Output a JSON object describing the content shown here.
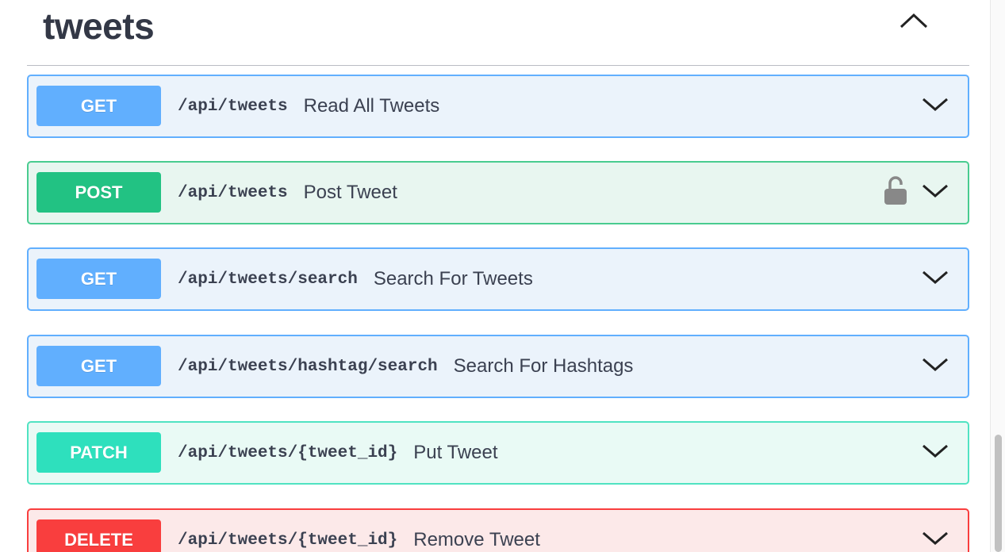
{
  "section": {
    "title": "tweets",
    "collapse_icon": "chevron-up-icon"
  },
  "operations": [
    {
      "method": "GET",
      "path": "/api/tweets",
      "summary": "Read All Tweets",
      "locked": false
    },
    {
      "method": "POST",
      "path": "/api/tweets",
      "summary": "Post Tweet",
      "locked": true,
      "lock_icon": "unlocked-padlock-icon"
    },
    {
      "method": "GET",
      "path": "/api/tweets/search",
      "summary": "Search For Tweets",
      "locked": false
    },
    {
      "method": "GET",
      "path": "/api/tweets/hashtag/search",
      "summary": "Search For Hashtags",
      "locked": false
    },
    {
      "method": "PATCH",
      "path": "/api/tweets/{tweet_id}",
      "summary": "Put Tweet",
      "locked": false
    },
    {
      "method": "DELETE",
      "path": "/api/tweets/{tweet_id}",
      "summary": "Remove Tweet",
      "locked": false
    }
  ],
  "expand_icon": "chevron-down-icon",
  "colors": {
    "get": "#61affe",
    "post": "#49cc90",
    "patch": "#50e3c2",
    "delete": "#f93e3e",
    "text": "#3b4151"
  }
}
